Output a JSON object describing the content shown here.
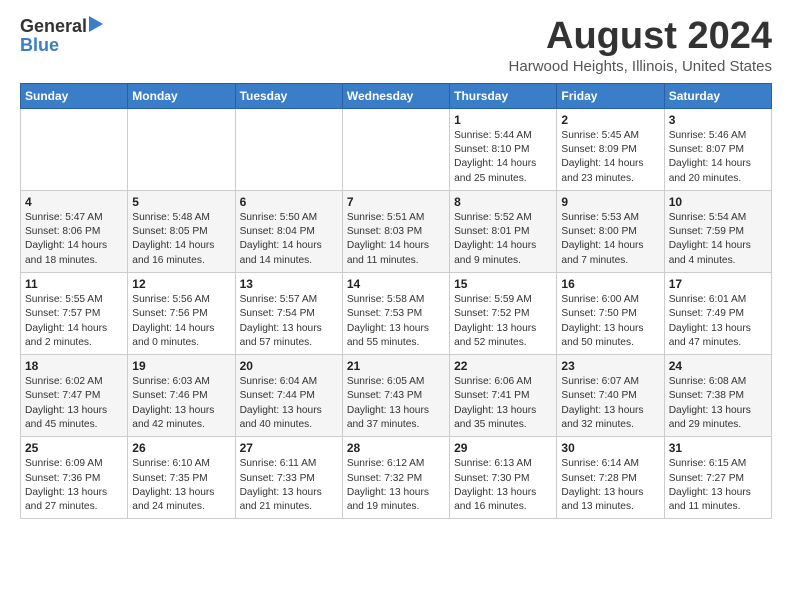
{
  "logo": {
    "line1": "General",
    "line2": "Blue"
  },
  "title": "August 2024",
  "subtitle": "Harwood Heights, Illinois, United States",
  "headers": [
    "Sunday",
    "Monday",
    "Tuesday",
    "Wednesday",
    "Thursday",
    "Friday",
    "Saturday"
  ],
  "weeks": [
    [
      {
        "day": "",
        "info": ""
      },
      {
        "day": "",
        "info": ""
      },
      {
        "day": "",
        "info": ""
      },
      {
        "day": "",
        "info": ""
      },
      {
        "day": "1",
        "info": "Sunrise: 5:44 AM\nSunset: 8:10 PM\nDaylight: 14 hours\nand 25 minutes."
      },
      {
        "day": "2",
        "info": "Sunrise: 5:45 AM\nSunset: 8:09 PM\nDaylight: 14 hours\nand 23 minutes."
      },
      {
        "day": "3",
        "info": "Sunrise: 5:46 AM\nSunset: 8:07 PM\nDaylight: 14 hours\nand 20 minutes."
      }
    ],
    [
      {
        "day": "4",
        "info": "Sunrise: 5:47 AM\nSunset: 8:06 PM\nDaylight: 14 hours\nand 18 minutes."
      },
      {
        "day": "5",
        "info": "Sunrise: 5:48 AM\nSunset: 8:05 PM\nDaylight: 14 hours\nand 16 minutes."
      },
      {
        "day": "6",
        "info": "Sunrise: 5:50 AM\nSunset: 8:04 PM\nDaylight: 14 hours\nand 14 minutes."
      },
      {
        "day": "7",
        "info": "Sunrise: 5:51 AM\nSunset: 8:03 PM\nDaylight: 14 hours\nand 11 minutes."
      },
      {
        "day": "8",
        "info": "Sunrise: 5:52 AM\nSunset: 8:01 PM\nDaylight: 14 hours\nand 9 minutes."
      },
      {
        "day": "9",
        "info": "Sunrise: 5:53 AM\nSunset: 8:00 PM\nDaylight: 14 hours\nand 7 minutes."
      },
      {
        "day": "10",
        "info": "Sunrise: 5:54 AM\nSunset: 7:59 PM\nDaylight: 14 hours\nand 4 minutes."
      }
    ],
    [
      {
        "day": "11",
        "info": "Sunrise: 5:55 AM\nSunset: 7:57 PM\nDaylight: 14 hours\nand 2 minutes."
      },
      {
        "day": "12",
        "info": "Sunrise: 5:56 AM\nSunset: 7:56 PM\nDaylight: 14 hours\nand 0 minutes."
      },
      {
        "day": "13",
        "info": "Sunrise: 5:57 AM\nSunset: 7:54 PM\nDaylight: 13 hours\nand 57 minutes."
      },
      {
        "day": "14",
        "info": "Sunrise: 5:58 AM\nSunset: 7:53 PM\nDaylight: 13 hours\nand 55 minutes."
      },
      {
        "day": "15",
        "info": "Sunrise: 5:59 AM\nSunset: 7:52 PM\nDaylight: 13 hours\nand 52 minutes."
      },
      {
        "day": "16",
        "info": "Sunrise: 6:00 AM\nSunset: 7:50 PM\nDaylight: 13 hours\nand 50 minutes."
      },
      {
        "day": "17",
        "info": "Sunrise: 6:01 AM\nSunset: 7:49 PM\nDaylight: 13 hours\nand 47 minutes."
      }
    ],
    [
      {
        "day": "18",
        "info": "Sunrise: 6:02 AM\nSunset: 7:47 PM\nDaylight: 13 hours\nand 45 minutes."
      },
      {
        "day": "19",
        "info": "Sunrise: 6:03 AM\nSunset: 7:46 PM\nDaylight: 13 hours\nand 42 minutes."
      },
      {
        "day": "20",
        "info": "Sunrise: 6:04 AM\nSunset: 7:44 PM\nDaylight: 13 hours\nand 40 minutes."
      },
      {
        "day": "21",
        "info": "Sunrise: 6:05 AM\nSunset: 7:43 PM\nDaylight: 13 hours\nand 37 minutes."
      },
      {
        "day": "22",
        "info": "Sunrise: 6:06 AM\nSunset: 7:41 PM\nDaylight: 13 hours\nand 35 minutes."
      },
      {
        "day": "23",
        "info": "Sunrise: 6:07 AM\nSunset: 7:40 PM\nDaylight: 13 hours\nand 32 minutes."
      },
      {
        "day": "24",
        "info": "Sunrise: 6:08 AM\nSunset: 7:38 PM\nDaylight: 13 hours\nand 29 minutes."
      }
    ],
    [
      {
        "day": "25",
        "info": "Sunrise: 6:09 AM\nSunset: 7:36 PM\nDaylight: 13 hours\nand 27 minutes."
      },
      {
        "day": "26",
        "info": "Sunrise: 6:10 AM\nSunset: 7:35 PM\nDaylight: 13 hours\nand 24 minutes."
      },
      {
        "day": "27",
        "info": "Sunrise: 6:11 AM\nSunset: 7:33 PM\nDaylight: 13 hours\nand 21 minutes."
      },
      {
        "day": "28",
        "info": "Sunrise: 6:12 AM\nSunset: 7:32 PM\nDaylight: 13 hours\nand 19 minutes."
      },
      {
        "day": "29",
        "info": "Sunrise: 6:13 AM\nSunset: 7:30 PM\nDaylight: 13 hours\nand 16 minutes."
      },
      {
        "day": "30",
        "info": "Sunrise: 6:14 AM\nSunset: 7:28 PM\nDaylight: 13 hours\nand 13 minutes."
      },
      {
        "day": "31",
        "info": "Sunrise: 6:15 AM\nSunset: 7:27 PM\nDaylight: 13 hours\nand 11 minutes."
      }
    ]
  ]
}
